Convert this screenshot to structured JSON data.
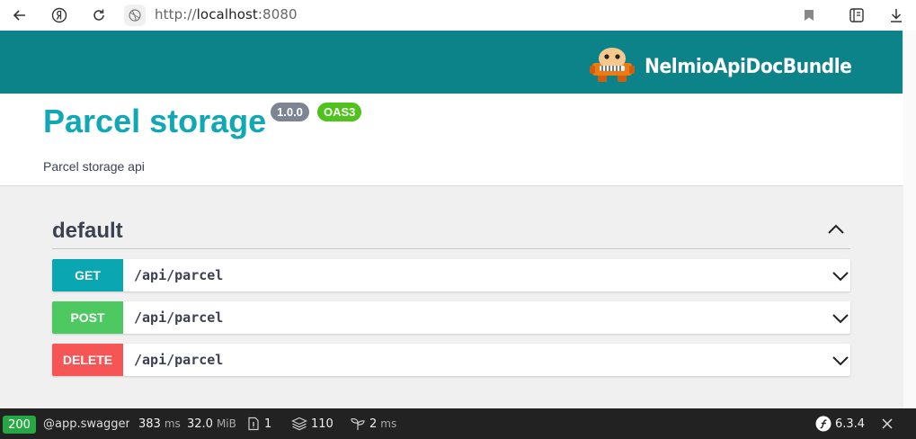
{
  "browser": {
    "url_scheme": "http://",
    "url_host": "localhost",
    "url_port": ":8080",
    "icons": [
      "back-arrow-icon",
      "yandex-icon",
      "reload-icon",
      "globe-icon",
      "bookmark-icon",
      "reader-icon",
      "download-icon"
    ]
  },
  "header": {
    "brand_name": "NelmioApiDocBundle"
  },
  "info": {
    "title": "Parcel storage",
    "version": "1.0.0",
    "spec": "OAS3",
    "description": "Parcel storage api"
  },
  "tag": {
    "name": "default",
    "operations": [
      {
        "method": "GET",
        "path": "/api/parcel",
        "color": "#0aa7b2"
      },
      {
        "method": "POST",
        "path": "/api/parcel",
        "color": "#4ec962"
      },
      {
        "method": "DELETE",
        "path": "/api/parcel",
        "color": "#f55555"
      }
    ]
  },
  "colors": {
    "header_bg": "#0b8389",
    "title": "#10a8b4",
    "version_badge": "#7d8492",
    "spec_badge": "#4fc21e"
  },
  "toolbar": {
    "status": "200",
    "route": "@app.swagger_ui",
    "time_value": "383",
    "time_unit": "ms",
    "memory_value": "32.0",
    "memory_unit": "MiB",
    "files": "1",
    "layers": "110",
    "twig_value": "2",
    "twig_unit": "ms",
    "version": "6.3.4"
  }
}
